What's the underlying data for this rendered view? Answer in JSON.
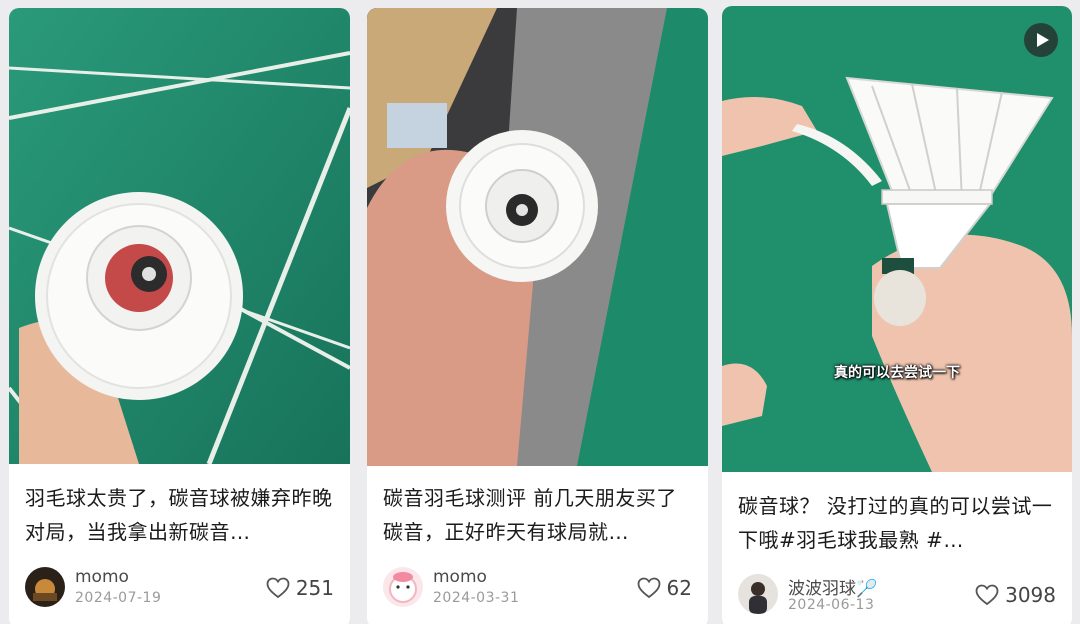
{
  "colors": {
    "court_green": "#1f8e6e",
    "card_bg": "#ffffff",
    "page_bg": "#ececee",
    "text": "#1b1b1b",
    "meta": "#9a9a9a"
  },
  "cards": [
    {
      "title": "羽毛球太贵了，碳音球被嫌弃昨晚对局，当我拿出新碳音…",
      "author": "momo",
      "date": "2024-07-19",
      "likes": "251",
      "image": "shuttlecock-held-over-green-court",
      "avatar": "dark-photo-avatar"
    },
    {
      "title": "碳音羽毛球测评 前几天朋友买了碳音，正好昨天有球局就…",
      "author": "momo",
      "date": "2024-03-31",
      "likes": "62",
      "image": "shuttlecock-held-in-hand-beside-court",
      "avatar": "cartoon-pink-avatar"
    },
    {
      "title": "碳音球？ 没打过的真的可以尝试一下哦#羽毛球我最熟 #…",
      "author": "波波羽球🏸",
      "date": "2024-06-13",
      "likes": "3098",
      "image": "shuttlecock-feather-bent-video",
      "avatar": "person-photo-avatar",
      "subtitle": "真的可以去尝试一下",
      "play_icon": "play-icon"
    }
  ]
}
